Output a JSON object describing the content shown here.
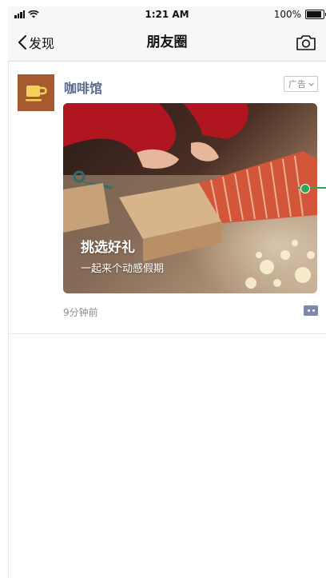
{
  "status_bar": {
    "time": "1:21 AM",
    "battery": "100%"
  },
  "nav": {
    "back_label": "发现",
    "title": "朋友圈"
  },
  "post": {
    "author": "咖啡馆",
    "ad_label": "广告",
    "ad_title": "挑选好礼",
    "ad_subtitle": "一起来个动感假期",
    "time": "9分钟前"
  },
  "colors": {
    "name_link": "#56698f",
    "accent_green": "#2ca55a",
    "avatar_bg": "#a65a2f"
  }
}
